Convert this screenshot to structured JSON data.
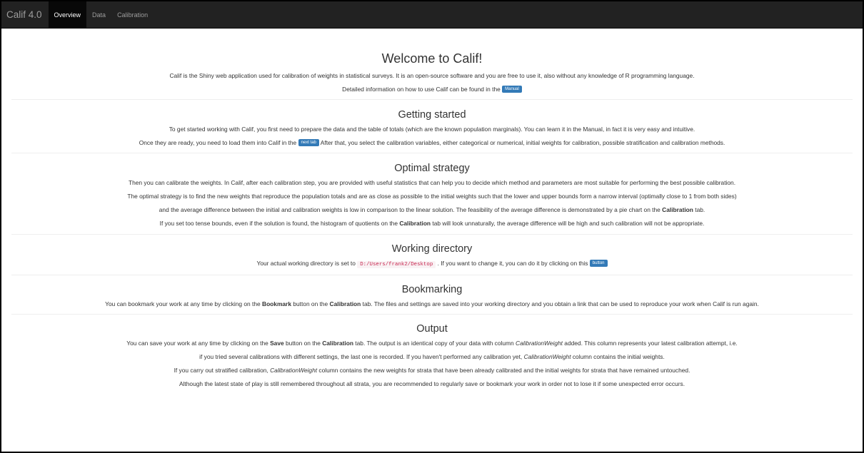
{
  "navbar": {
    "brand": "Calif 4.0",
    "tabs": [
      {
        "label": "Overview",
        "active": true
      },
      {
        "label": "Data",
        "active": false
      },
      {
        "label": "Calibration",
        "active": false
      }
    ]
  },
  "welcome": {
    "title": "Welcome to Calif!",
    "p1": "Calif is the Shiny web application used for calibration of weights in statistical surveys. It is an open-source software and you are free to use it, also without any knowledge of R programming language.",
    "p2_before": "Detailed information on how to use Calif can be found in the",
    "manual_button": "Manual"
  },
  "getting_started": {
    "title": "Getting started",
    "p1": "To get started working with Calif, you first need to prepare the data and the table of totals (which are the known population marginals). You can learn it in the Manual, in fact it is very easy and intuitive.",
    "p2_before": "Once they are ready, you need to load them into Calif in the",
    "next_tab_button": "next tab",
    "p2_after": "After that, you select the calibration variables, either categorical or numerical, initial weights for calibration, possible stratification and calibration methods."
  },
  "optimal_strategy": {
    "title": "Optimal strategy",
    "p1": "Then you can calibrate the weights. In Calif, after each calibration step, you are provided with useful statistics that can help you to decide which method and parameters are most suitable for performing the best possible calibration.",
    "p2": "The optimal strategy is to find the new weights that reproduce the population totals and are as close as possible to the initial weights such that the lower and upper bounds form a narrow interval (optimally close to 1 from both sides)",
    "p3_before": "and the average difference between the initial and calibration weights is low in comparison to the linear solution. The feasibility of the average difference is demonstrated by a pie chart on the",
    "p3_bold": "Calibration",
    "p3_after": "tab.",
    "p4_before": "If you set too tense bounds, even if the solution is found, the histogram of quotients on the",
    "p4_bold": "Calibration",
    "p4_after": "tab will look unnaturally, the average difference will be high and such calibration will not be appropriate."
  },
  "working_directory": {
    "title": "Working directory",
    "before": "Your actual working directory is set to",
    "path": "D:/Users/frank2/Desktop",
    "after": ". If you want to change it, you can do it by clicking on this",
    "button": "button"
  },
  "bookmarking": {
    "title": "Bookmarking",
    "before": "You can bookmark your work at any time by clicking on the",
    "bold1": "Bookmark",
    "mid": "button on the",
    "bold2": "Calibration",
    "after": "tab. The files and settings are saved into your working directory and you obtain a link that can be used to reproduce your work when Calif is run again."
  },
  "output": {
    "title": "Output",
    "p1_before": "You can save your work at any time by clicking on the",
    "p1_bold1": "Save",
    "p1_mid1": "button on the",
    "p1_bold2": "Calibration",
    "p1_mid2": "tab. The output is an identical copy of your data with column",
    "p1_italic": "CalibrationWeight",
    "p1_after": "added. This column represents your latest calibration attempt, i.e.",
    "p2_before": "if you tried several calibrations with different settings, the last one is recorded. If you haven't performed any calibration yet,",
    "p2_italic": "CalibrationWeight",
    "p2_after": "column contains the initial weights.",
    "p3_before": "If you carry out stratified calibration,",
    "p3_italic": "CalibrationWeight",
    "p3_after": "column contains the new weights for strata that have been already calibrated and the initial weights for strata that have remained untouched.",
    "p4": "Although the latest state of play is still remembered throughout all strata, you are recommended to regularly save or bookmark your work in order not to lose it if some unexpected error occurs."
  },
  "colors": {
    "navbar": "#222222",
    "active_tab": "#080808",
    "button": "#337ab7",
    "code_text": "#c7254e"
  }
}
